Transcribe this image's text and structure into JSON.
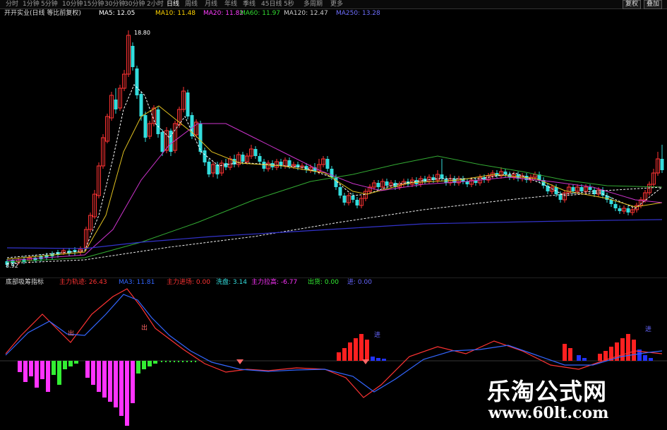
{
  "toolbar": {
    "timeframes": [
      {
        "label": "分时",
        "active": false
      },
      {
        "label": "1分钟",
        "active": false
      },
      {
        "label": "5分钟",
        "active": false
      },
      {
        "label": "10分钟",
        "active": false
      },
      {
        "label": "15分钟",
        "active": false
      },
      {
        "label": "30分钟",
        "active": false
      },
      {
        "label": "30分钟",
        "active": false
      },
      {
        "label": "2小时",
        "active": false
      },
      {
        "label": "日线",
        "active": true
      },
      {
        "label": "周线",
        "active": false
      },
      {
        "label": "月线",
        "active": false
      },
      {
        "label": "年线",
        "active": false
      },
      {
        "label": "季线",
        "active": false
      },
      {
        "label": "45日线",
        "active": false
      },
      {
        "label": "5秒",
        "active": false
      },
      {
        "label": "多周期",
        "active": false
      },
      {
        "label": "更多",
        "active": false
      }
    ],
    "right_buttons": [
      "复权",
      "叠加"
    ]
  },
  "ma_legend": {
    "stock_name": "开开实业(日线 等比前复权)",
    "items": [
      {
        "label": "MA5: 12.05",
        "color": "#ffffff"
      },
      {
        "label": "MA10: 11.48",
        "color": "#ffd400"
      },
      {
        "label": "MA20: 11.82",
        "color": "#ff3fff"
      },
      {
        "label": "MA60: 11.97",
        "color": "#33dd33"
      },
      {
        "label": "MA120: 12.47",
        "color": "#cccccc"
      },
      {
        "label": "MA250: 13.28",
        "color": "#6f6fff"
      }
    ]
  },
  "main_chart": {
    "price_high_label": "18.80",
    "price_low_label": "8.92",
    "colors": {
      "up": "#ff3333",
      "down": "#33dddd",
      "ma5": "#ffffff",
      "ma10": "#e0c020",
      "ma20": "#cc33cc",
      "ma60": "#33aa33",
      "ma120": "#eeeeee",
      "ma250": "#3333cc"
    }
  },
  "indicator_legend": {
    "title": "底部吸筹指标",
    "items": [
      {
        "label": "主力轨迹: 26.43",
        "color": "#ff3333"
      },
      {
        "label": "MA3: 11.81",
        "color": "#3366ff"
      },
      {
        "label": "主力进场: 0.00",
        "color": "#ff3333"
      },
      {
        "label": "洗盘: 3.14",
        "color": "#33dddd"
      },
      {
        "label": "主力拉高: -6.77",
        "color": "#ff33ff"
      },
      {
        "label": "出货: 0.00",
        "color": "#33ee33"
      },
      {
        "label": "进: 0.00",
        "color": "#6666ff"
      }
    ]
  },
  "indicator_chart": {
    "marks": [
      "进",
      "进"
    ],
    "sell_labels": [
      "出",
      "出"
    ]
  },
  "watermark": {
    "title": "乐淘公式网",
    "url": "www.60lt.com"
  }
}
